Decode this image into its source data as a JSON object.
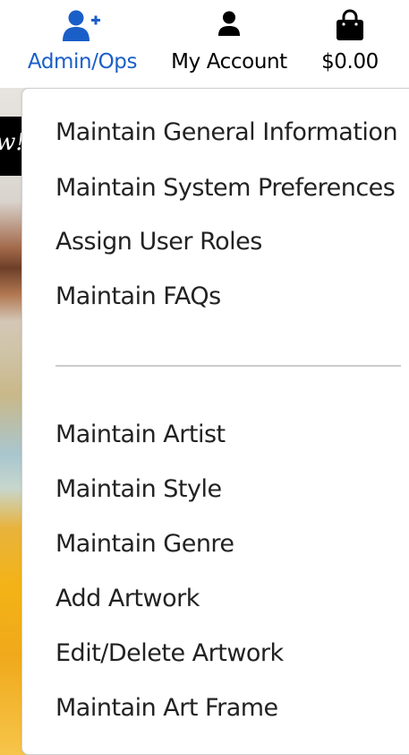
{
  "nav": {
    "admin": {
      "label": "Admin/Ops",
      "icon": "user-plus-icon",
      "color": "#1a5fc8"
    },
    "account": {
      "label": "My Account",
      "icon": "user-icon"
    },
    "cart": {
      "label": "$0.00",
      "icon": "shopping-bag-icon"
    }
  },
  "background": {
    "banner_text": "w!"
  },
  "menu": {
    "group1": [
      {
        "label": "Maintain General Information"
      },
      {
        "label": "Maintain System Preferences"
      },
      {
        "label": "Assign User Roles"
      },
      {
        "label": "Maintain FAQs"
      }
    ],
    "group2": [
      {
        "label": "Maintain Artist"
      },
      {
        "label": "Maintain Style"
      },
      {
        "label": "Maintain Genre"
      },
      {
        "label": "Add Artwork"
      },
      {
        "label": "Edit/Delete Artwork"
      },
      {
        "label": "Maintain Art Frame"
      }
    ]
  }
}
